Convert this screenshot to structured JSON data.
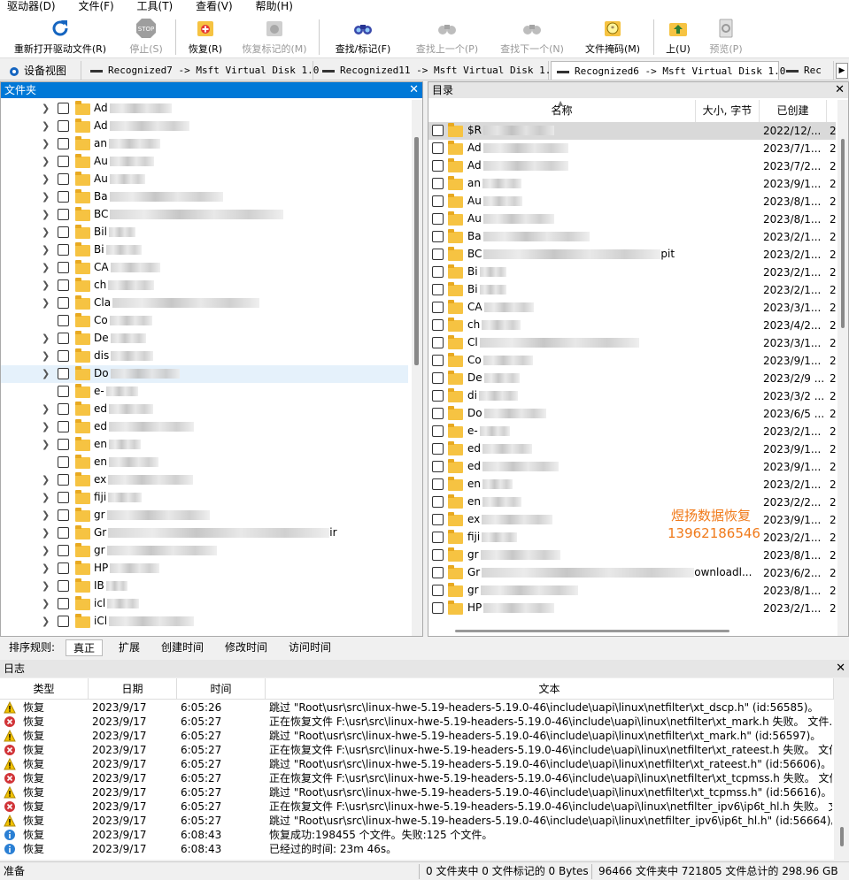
{
  "menu": [
    "驱动器(D)",
    "文件(F)",
    "工具(T)",
    "查看(V)",
    "帮助(H)"
  ],
  "toolbar": {
    "reopen": "重新打开驱动文件(R)",
    "stop": "停止(S)",
    "recover": "恢复(R)",
    "recover_marked": "恢复标记的(M)",
    "find_mark": "查找/标记(F)",
    "find_prev": "查找上一个(P)",
    "find_next": "查找下一个(N)",
    "file_mask": "文件掩码(M)",
    "up": "上(U)",
    "preview": "预览(P)",
    "stop_icon_text": "STOP"
  },
  "tabs": [
    "设备视图",
    "Recognized7 -> Msft Virtual Disk 1.0",
    "Recognized11 -> Msft Virtual Disk 1.0",
    "Recognized6 -> Msft Virtual Disk 1.0",
    "Rec"
  ],
  "folders_pane": {
    "title": "文件夹",
    "items": [
      {
        "label": "Ad",
        "expandable": true
      },
      {
        "label": "Ad",
        "expandable": true
      },
      {
        "label": "an",
        "expandable": true
      },
      {
        "label": "Au",
        "expandable": true
      },
      {
        "label": "Au",
        "expandable": true
      },
      {
        "label": "Ba",
        "expandable": true
      },
      {
        "label": "BC",
        "expandable": true
      },
      {
        "label": "Bil",
        "expandable": true
      },
      {
        "label": "Bi",
        "expandable": true
      },
      {
        "label": "CA",
        "expandable": true
      },
      {
        "label": "ch",
        "expandable": true
      },
      {
        "label": "Cla",
        "expandable": true
      },
      {
        "label": "Co",
        "expandable": false
      },
      {
        "label": "De",
        "expandable": true
      },
      {
        "label": "dis",
        "expandable": true
      },
      {
        "label": "Do",
        "expandable": true,
        "selected": true
      },
      {
        "label": "e-",
        "expandable": false
      },
      {
        "label": "ed",
        "expandable": true
      },
      {
        "label": "ed",
        "expandable": true
      },
      {
        "label": "en",
        "expandable": true
      },
      {
        "label": "en",
        "expandable": false
      },
      {
        "label": "ex",
        "expandable": true
      },
      {
        "label": "fiji",
        "expandable": true
      },
      {
        "label": "gr",
        "expandable": true
      },
      {
        "label": "Gr",
        "expandable": true,
        "tail": "ir"
      },
      {
        "label": "gr",
        "expandable": true
      },
      {
        "label": "HP",
        "expandable": true
      },
      {
        "label": "IB",
        "expandable": true
      },
      {
        "label": "icl",
        "expandable": true
      },
      {
        "label": "iCl",
        "expandable": true
      }
    ]
  },
  "directory_pane": {
    "title": "目录",
    "columns": [
      "名称",
      "大小, 字节",
      "已创建"
    ],
    "rows": [
      {
        "name": "$R",
        "date": "2022/12/...",
        "selected": true
      },
      {
        "name": "Ad",
        "date": "2023/7/1..."
      },
      {
        "name": "Ad",
        "date": "2023/7/2..."
      },
      {
        "name": "an",
        "date": "2023/9/1..."
      },
      {
        "name": "Au",
        "date": "2023/8/1..."
      },
      {
        "name": "Au",
        "date": "2023/8/1..."
      },
      {
        "name": "Ba",
        "date": "2023/2/1..."
      },
      {
        "name": "BC",
        "date": "2023/2/1...",
        "tail": "pit"
      },
      {
        "name": "Bi",
        "date": "2023/2/1..."
      },
      {
        "name": "Bi",
        "date": "2023/2/1..."
      },
      {
        "name": "CA",
        "date": "2023/3/1..."
      },
      {
        "name": "ch",
        "date": "2023/4/2..."
      },
      {
        "name": "Cl",
        "date": "2023/3/1..."
      },
      {
        "name": "Co",
        "date": "2023/9/1..."
      },
      {
        "name": "De",
        "date": "2023/2/9 ..."
      },
      {
        "name": "di",
        "date": "2023/3/2 ..."
      },
      {
        "name": "Do",
        "date": "2023/6/5 ..."
      },
      {
        "name": "e-",
        "date": "2023/2/1..."
      },
      {
        "name": "ed",
        "date": "2023/9/1..."
      },
      {
        "name": "ed",
        "date": "2023/9/1..."
      },
      {
        "name": "en",
        "date": "2023/2/1..."
      },
      {
        "name": "en",
        "date": "2023/2/2..."
      },
      {
        "name": "ex",
        "date": "2023/9/1..."
      },
      {
        "name": "fiji",
        "date": "2023/2/1..."
      },
      {
        "name": "gr",
        "date": "2023/8/1..."
      },
      {
        "name": "Gr",
        "date": "2023/6/2...",
        "tail": "ownloadl..."
      },
      {
        "name": "gr",
        "date": "2023/8/1..."
      },
      {
        "name": "HP",
        "date": "2023/2/1..."
      }
    ],
    "trailing_digit": "2"
  },
  "watermark": {
    "line1": "煜扬数据恢复",
    "line2": "13962186546"
  },
  "sort_bar": {
    "label": "排序规则:",
    "options": [
      "真正",
      "扩展",
      "创建时间",
      "修改时间",
      "访问时间"
    ]
  },
  "log": {
    "title": "日志",
    "columns": [
      "类型",
      "日期",
      "时间",
      "文本"
    ],
    "rows": [
      {
        "icon": "warning",
        "type": "恢复",
        "date": "2023/9/17",
        "time": "6:05:26",
        "text": "跳过 \"Root\\usr\\src\\linux-hwe-5.19-headers-5.19.0-46\\include\\uapi\\linux\\netfilter\\xt_dscp.h\" (id:56585)。"
      },
      {
        "icon": "error",
        "type": "恢复",
        "date": "2023/9/17",
        "time": "6:05:27",
        "text": "正在恢复文件 F:\\usr\\src\\linux-hwe-5.19-headers-5.19.0-46\\include\\uapi\\linux\\netfilter\\xt_mark.h 失败。 文件..."
      },
      {
        "icon": "warning",
        "type": "恢复",
        "date": "2023/9/17",
        "time": "6:05:27",
        "text": "跳过 \"Root\\usr\\src\\linux-hwe-5.19-headers-5.19.0-46\\include\\uapi\\linux\\netfilter\\xt_mark.h\" (id:56597)。"
      },
      {
        "icon": "error",
        "type": "恢复",
        "date": "2023/9/17",
        "time": "6:05:27",
        "text": "正在恢复文件 F:\\usr\\src\\linux-hwe-5.19-headers-5.19.0-46\\include\\uapi\\linux\\netfilter\\xt_rateest.h 失败。 文件..."
      },
      {
        "icon": "warning",
        "type": "恢复",
        "date": "2023/9/17",
        "time": "6:05:27",
        "text": "跳过 \"Root\\usr\\src\\linux-hwe-5.19-headers-5.19.0-46\\include\\uapi\\linux\\netfilter\\xt_rateest.h\" (id:56606)。"
      },
      {
        "icon": "error",
        "type": "恢复",
        "date": "2023/9/17",
        "time": "6:05:27",
        "text": "正在恢复文件 F:\\usr\\src\\linux-hwe-5.19-headers-5.19.0-46\\include\\uapi\\linux\\netfilter\\xt_tcpmss.h 失败。 文件..."
      },
      {
        "icon": "warning",
        "type": "恢复",
        "date": "2023/9/17",
        "time": "6:05:27",
        "text": "跳过 \"Root\\usr\\src\\linux-hwe-5.19-headers-5.19.0-46\\include\\uapi\\linux\\netfilter\\xt_tcpmss.h\" (id:56616)。"
      },
      {
        "icon": "error",
        "type": "恢复",
        "date": "2023/9/17",
        "time": "6:05:27",
        "text": "正在恢复文件 F:\\usr\\src\\linux-hwe-5.19-headers-5.19.0-46\\include\\uapi\\linux\\netfilter_ipv6\\ip6t_hl.h 失败。 文..."
      },
      {
        "icon": "warning",
        "type": "恢复",
        "date": "2023/9/17",
        "time": "6:05:27",
        "text": "跳过 \"Root\\usr\\src\\linux-hwe-5.19-headers-5.19.0-46\\include\\uapi\\linux\\netfilter_ipv6\\ip6t_hl.h\" (id:56664)。"
      },
      {
        "icon": "info",
        "type": "恢复",
        "date": "2023/9/17",
        "time": "6:08:43",
        "text": "恢复成功:198455 个文件。失败:125 个文件。"
      },
      {
        "icon": "info",
        "type": "恢复",
        "date": "2023/9/17",
        "time": "6:08:43",
        "text": "已经过的时间: 23m 46s。"
      }
    ]
  },
  "status": {
    "ready": "准备",
    "marked": "0 文件夹中 0 文件标记的 0 Bytes",
    "totals": "96466 文件夹中 721805 文件总计的 298.96 GB"
  },
  "colors": {
    "accent": "#0078d7",
    "folder": "#f6c342",
    "warning": "#f2c200",
    "error": "#d13438",
    "info": "#2a7fd4",
    "watermark": "#f07a1a"
  }
}
